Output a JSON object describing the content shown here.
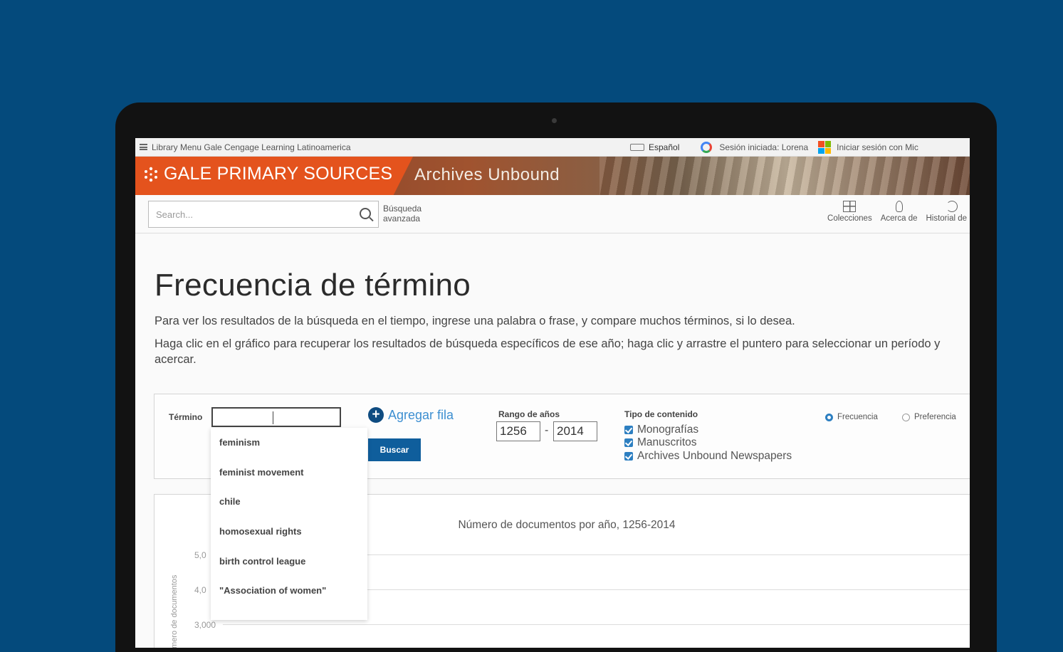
{
  "utility_bar": {
    "menu_text": "Library Menu Gale Cengage Learning Latinoamerica",
    "language": "Español",
    "google_session": "Sesión iniciada: Lorena",
    "microsoft_signin": "Iniciar sesión con Mic"
  },
  "banner": {
    "brand": "GALE PRIMARY SOURCES",
    "product": "Archives Unbound"
  },
  "search": {
    "placeholder": "Search...",
    "advanced_label": "Búsqueda avanzada"
  },
  "nav": {
    "collections": "Colecciones",
    "about": "Acerca de",
    "history": "Historial de bú"
  },
  "page": {
    "title": "Frecuencia de término",
    "intro_1": "Para ver los resultados de la búsqueda en el tiempo, ingrese una palabra o frase, y compare muchos términos, si lo desea.",
    "intro_2": "Haga clic en el gráfico para recuperar los resultados de búsqueda específicos de ese año; haga clic y arrastre el puntero para seleccionar un período y acercar."
  },
  "controls": {
    "term_label": "Término",
    "term_value": "",
    "add_row_label": "Agregar fila",
    "search_button": "Buscar",
    "year_range_label": "Rango de años",
    "year_from": "1256",
    "year_to": "2014",
    "content_type_label": "Tipo de contenido",
    "content_types": [
      "Monografías",
      "Manuscritos",
      "Archives Unbound Newspapers"
    ],
    "mode_frequency": "Frecuencia",
    "mode_preference": "Preferencia"
  },
  "suggestions": [
    "feminism",
    "feminist movement",
    "chile",
    "homosexual rights",
    "birth control league",
    "\"Association of women\""
  ],
  "chart": {
    "title": "Número de documentos por año, 1256-2014",
    "ylabel": "Número de documentos",
    "ticks": [
      "5,0",
      "4,0",
      "3,000"
    ]
  },
  "colors": {
    "background": "#044a7c",
    "brand_orange": "#e4531d",
    "button_blue": "#0f5e9c",
    "link_blue": "#3d8fd1"
  }
}
